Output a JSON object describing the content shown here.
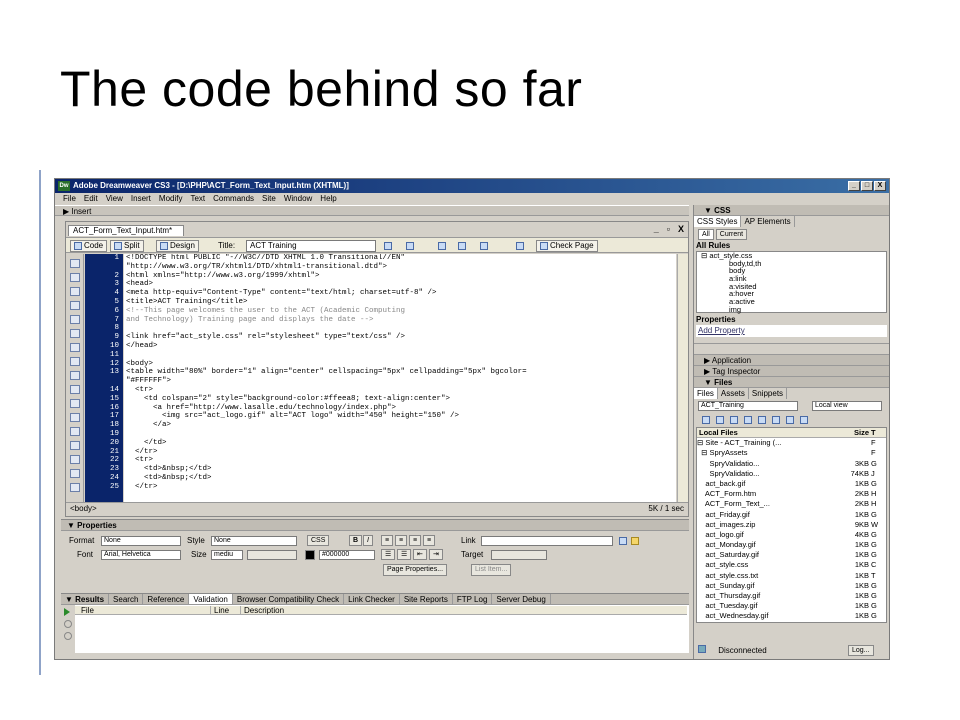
{
  "slide_title": "The code behind so far",
  "window": {
    "title": "Adobe Dreamweaver CS3 - [D:\\PHP\\ACT_Form_Text_Input.htm (XHTML)]",
    "controls": [
      "_",
      "□",
      "X"
    ]
  },
  "menu": [
    "File",
    "Edit",
    "View",
    "Insert",
    "Modify",
    "Text",
    "Commands",
    "Site",
    "Window",
    "Help"
  ],
  "insert_bar": "▶ Insert",
  "document": {
    "tab": "ACT_Form_Text_Input.htm*",
    "tab_buttons": [
      "_",
      "▫",
      "X"
    ],
    "toolbar": {
      "code": "Code",
      "split": "Split",
      "design": "Design",
      "title_label": "Title:",
      "title_value": "ACT Training",
      "check_page": "Check Page"
    },
    "line_numbers": [
      "1",
      "",
      "2",
      "3",
      "4",
      "5",
      "6",
      "7",
      "8",
      "9",
      "10",
      "11",
      "12",
      "13",
      "",
      "14",
      "15",
      "16",
      "17",
      "18",
      "19",
      "20",
      "21",
      "22",
      "23",
      "24",
      "25"
    ],
    "code_lines": [
      "<!DOCTYPE html PUBLIC \"-//W3C//DTD XHTML 1.0 Transitional//EN\"",
      "\"http://www.w3.org/TR/xhtml1/DTD/xhtml1-transitional.dtd\">",
      "<html xmlns=\"http://www.w3.org/1999/xhtml\">",
      "<head>",
      "<meta http-equiv=\"Content-Type\" content=\"text/html; charset=utf-8\" />",
      "<title>ACT Training</title>",
      "<!--This page welcomes the user to the ACT (Academic Computing",
      "and Technology) Training page and displays the date -->",
      "",
      "<link href=\"act_style.css\" rel=\"stylesheet\" type=\"text/css\" />",
      "</head>",
      "",
      "<body>",
      "<table width=\"80%\" border=\"1\" align=\"center\" cellspacing=\"5px\" cellpadding=\"5px\" bgcolor=",
      "\"#FFFFFF\">",
      "  <tr>",
      "    <td colspan=\"2\" style=\"background-color:#ffeea8; text-align:center\">",
      "      <a href=\"http://www.lasalle.edu/technology/index.php\">",
      "        <img src=\"act_logo.gif\" alt=\"ACT logo\" width=\"450\" height=\"150\" />",
      "      </a>",
      "",
      "    </td>",
      "  </tr>",
      "  <tr>",
      "    <td>&nbsp;</td>",
      "    <td>&nbsp;</td>",
      "  </tr>"
    ],
    "status_left": "<body>",
    "status_right": "5K / 1 sec"
  },
  "properties": {
    "header": "▼ Properties",
    "format_label": "Format",
    "format_value": "None",
    "style_label": "Style",
    "style_value": "None",
    "css_button": "CSS",
    "link_label": "Link",
    "font_label": "Font",
    "font_value": "Arial, Helvetica",
    "size_label": "Size",
    "size_value": "mediu",
    "color_value": "#000000",
    "target_label": "Target",
    "page_props_button": "Page Properties...",
    "list_item_button": "List Item..."
  },
  "results": {
    "tabs": [
      "▼ Results",
      "Search",
      "Reference",
      "Validation",
      "Browser Compatibility Check",
      "Link Checker",
      "Site Reports",
      "FTP Log",
      "Server Debug"
    ],
    "columns": [
      "File",
      "Line",
      "Description"
    ]
  },
  "css_panel": {
    "header": "▼ CSS",
    "tabs": [
      "CSS Styles",
      "AP Elements"
    ],
    "mode_buttons": [
      "All",
      "Current"
    ],
    "all_rules_label": "All Rules",
    "rules": [
      "⊟ act_style.css",
      "body,td,th",
      "body",
      "a:link",
      "a:visited",
      "a:hover",
      "a:active",
      "img"
    ],
    "properties_label": "Properties",
    "add_property": "Add Property"
  },
  "collapsed_panels": [
    "▶ Application",
    "▶ Tag Inspector"
  ],
  "files_panel": {
    "header": "▼ Files",
    "tabs": [
      "Files",
      "Assets",
      "Snippets"
    ],
    "site_select": "ACT_Training",
    "view_select": "Local view",
    "col_local": "Local Files",
    "col_size": "Size",
    "col_type": "T",
    "rows": [
      {
        "name": "⊟ Site - ACT_Training (...",
        "size": "",
        "type": "F"
      },
      {
        "name": "  ⊟ SpryAssets",
        "size": "",
        "type": "F"
      },
      {
        "name": "      SpryValidatio...",
        "size": "3KB",
        "type": "G"
      },
      {
        "name": "      SpryValidatio...",
        "size": "74KB",
        "type": "J"
      },
      {
        "name": "    act_back.gif",
        "size": "1KB",
        "type": "G"
      },
      {
        "name": "    ACT_Form.htm",
        "size": "2KB",
        "type": "H"
      },
      {
        "name": "    ACT_Form_Text_...",
        "size": "2KB",
        "type": "H"
      },
      {
        "name": "    act_Friday.gif",
        "size": "1KB",
        "type": "G"
      },
      {
        "name": "    act_images.zip",
        "size": "9KB",
        "type": "W"
      },
      {
        "name": "    act_logo.gif",
        "size": "4KB",
        "type": "G"
      },
      {
        "name": "    act_Monday.gif",
        "size": "1KB",
        "type": "G"
      },
      {
        "name": "    act_Saturday.gif",
        "size": "1KB",
        "type": "G"
      },
      {
        "name": "    act_style.css",
        "size": "1KB",
        "type": "C"
      },
      {
        "name": "    act_style.css.txt",
        "size": "1KB",
        "type": "T"
      },
      {
        "name": "    act_Sunday.gif",
        "size": "1KB",
        "type": "G"
      },
      {
        "name": "    act_Thursday.gif",
        "size": "1KB",
        "type": "G"
      },
      {
        "name": "    act_Tuesday.gif",
        "size": "1KB",
        "type": "G"
      },
      {
        "name": "    act_Wednesday.gif",
        "size": "1KB",
        "type": "G"
      }
    ],
    "status": "Disconnected",
    "log_button": "Log..."
  }
}
